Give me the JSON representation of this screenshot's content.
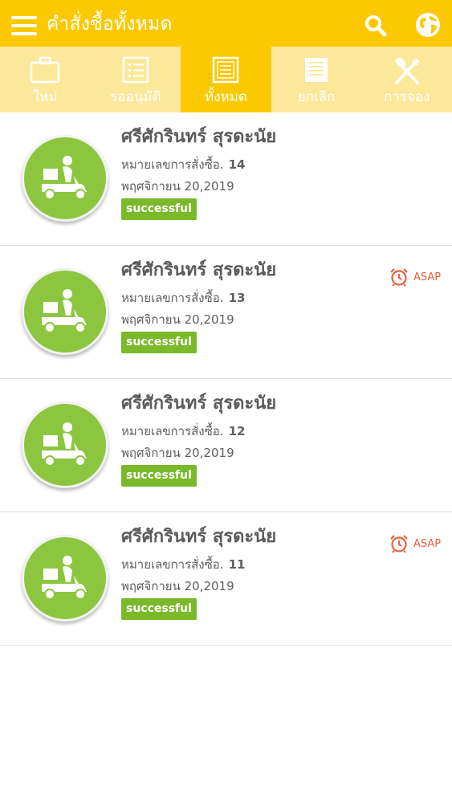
{
  "header": {
    "title": "คำสั่งซื้อทั้งหมด",
    "menu_icon": "hamburger-menu-icon",
    "search_icon": "search-icon",
    "language_icon": "globe-icon",
    "background": "#fcc900"
  },
  "tabs": [
    {
      "label": "ใหม่",
      "icon": "briefcase-icon",
      "active": false
    },
    {
      "label": "รออนุมัติ",
      "icon": "checklist-icon",
      "active": false
    },
    {
      "label": "ทั้งหมด",
      "icon": "document-icon",
      "active": true
    },
    {
      "label": "ยกเลิก",
      "icon": "notepad-icon",
      "active": false
    },
    {
      "label": "การจอง",
      "icon": "fork-spoon-icon",
      "active": false
    }
  ],
  "orders": [
    {
      "customer": "ศรีศักรินทร์ สุรดะนัย",
      "order_label": "หมายเลขการสั่งซื้อ.",
      "order_number": "14",
      "date": "พฤศจิกายน 20,2019",
      "status": "successful",
      "asap": "",
      "icon": "delivery-scooter-icon"
    },
    {
      "customer": "ศรีศักรินทร์ สุรดะนัย",
      "order_label": "หมายเลขการสั่งซื้อ.",
      "order_number": "13",
      "date": "พฤศจิกายน 20,2019",
      "status": "successful",
      "asap": "ASAP",
      "icon": "delivery-scooter-icon"
    },
    {
      "customer": "ศรีศักรินทร์ สุรดะนัย",
      "order_label": "หมายเลขการสั่งซื้อ.",
      "order_number": "12",
      "date": "พฤศจิกายน 20,2019",
      "status": "successful",
      "asap": "",
      "icon": "delivery-scooter-icon"
    },
    {
      "customer": "ศรีศักรินทร์ สุรดะนัย",
      "order_label": "หมายเลขการสั่งซื้อ.",
      "order_number": "11",
      "date": "พฤศจิกายน 20,2019",
      "status": "successful",
      "asap": "ASAP",
      "icon": "delivery-scooter-icon"
    }
  ],
  "colors": {
    "tab_bar": "#fce89a",
    "avatar_green": "#8cc63f",
    "status_green": "#7ab929",
    "asap_orange": "#e8613c"
  }
}
